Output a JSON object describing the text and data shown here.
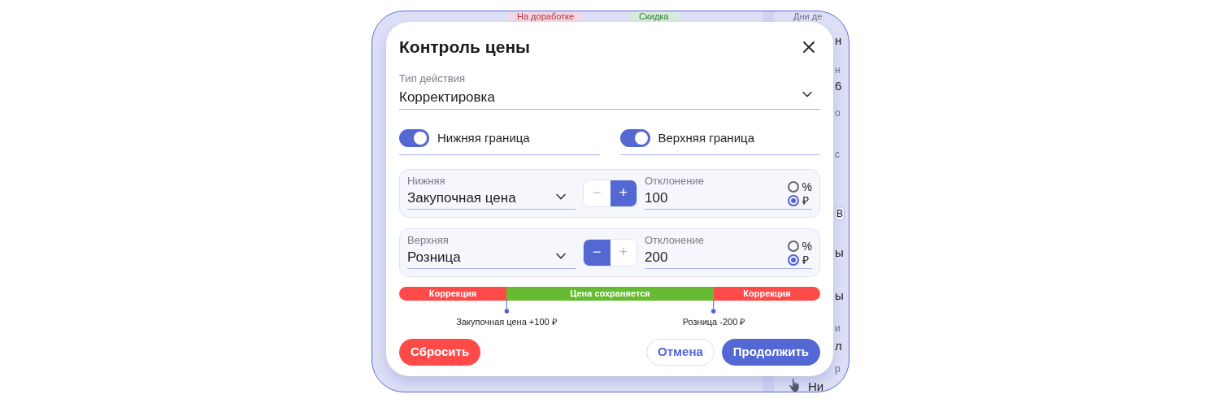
{
  "background": {
    "badges": [
      {
        "label": "На доработке",
        "color": "#c0303a"
      },
      {
        "label": "Скидка",
        "color": "#2e7d32"
      }
    ],
    "fragments": [
      {
        "text": "Дни де",
        "kind": "label"
      },
      {
        "text": "н",
        "kind": "value"
      },
      {
        "text": "н",
        "kind": "label"
      },
      {
        "text": "6",
        "kind": "value"
      },
      {
        "text": "о",
        "kind": "label"
      },
      {
        "text": "с",
        "kind": "label"
      },
      {
        "text": "В",
        "kind": "chip"
      },
      {
        "text": "ы",
        "kind": "value"
      },
      {
        "text": "ы",
        "kind": "value"
      },
      {
        "text": "и",
        "kind": "label"
      },
      {
        "text": "л",
        "kind": "value"
      },
      {
        "text": "р",
        "kind": "label"
      },
      {
        "text": "Ни",
        "kind": "value"
      }
    ]
  },
  "dialog": {
    "title": "Контроль цены",
    "action_type": {
      "label": "Тип действия",
      "value": "Корректировка"
    },
    "toggles": [
      {
        "label": "Нижняя граница",
        "on": true
      },
      {
        "label": "Верхняя граница",
        "on": true
      }
    ],
    "bounds": [
      {
        "label": "Нижняя",
        "value": "Закупочная цена",
        "stepper": [
          {
            "label": "−",
            "selected": false
          },
          {
            "label": "+",
            "selected": true
          }
        ],
        "deviation": {
          "label": "Отклонение",
          "value": "100"
        },
        "units": [
          {
            "label": "%",
            "selected": false
          },
          {
            "label": "₽",
            "selected": true
          }
        ]
      },
      {
        "label": "Верхняя",
        "value": "Розница",
        "stepper": [
          {
            "label": "−",
            "selected": true
          },
          {
            "label": "+",
            "selected": false
          }
        ],
        "deviation": {
          "label": "Отклонение",
          "value": "200"
        },
        "units": [
          {
            "label": "%",
            "selected": false
          },
          {
            "label": "₽",
            "selected": true
          }
        ]
      }
    ],
    "scale": {
      "segments": [
        {
          "label": "Коррекция",
          "color": "#ff4a4a"
        },
        {
          "label": "Цена сохраняется",
          "color": "#67bb33"
        },
        {
          "label": "Коррекция",
          "color": "#ff4a4a"
        }
      ],
      "markers": [
        "Закупочная цена +100 ₽",
        "Розница -200 ₽"
      ]
    },
    "buttons": {
      "reset": "Сбросить",
      "cancel": "Отмена",
      "continue": "Продолжить"
    }
  }
}
